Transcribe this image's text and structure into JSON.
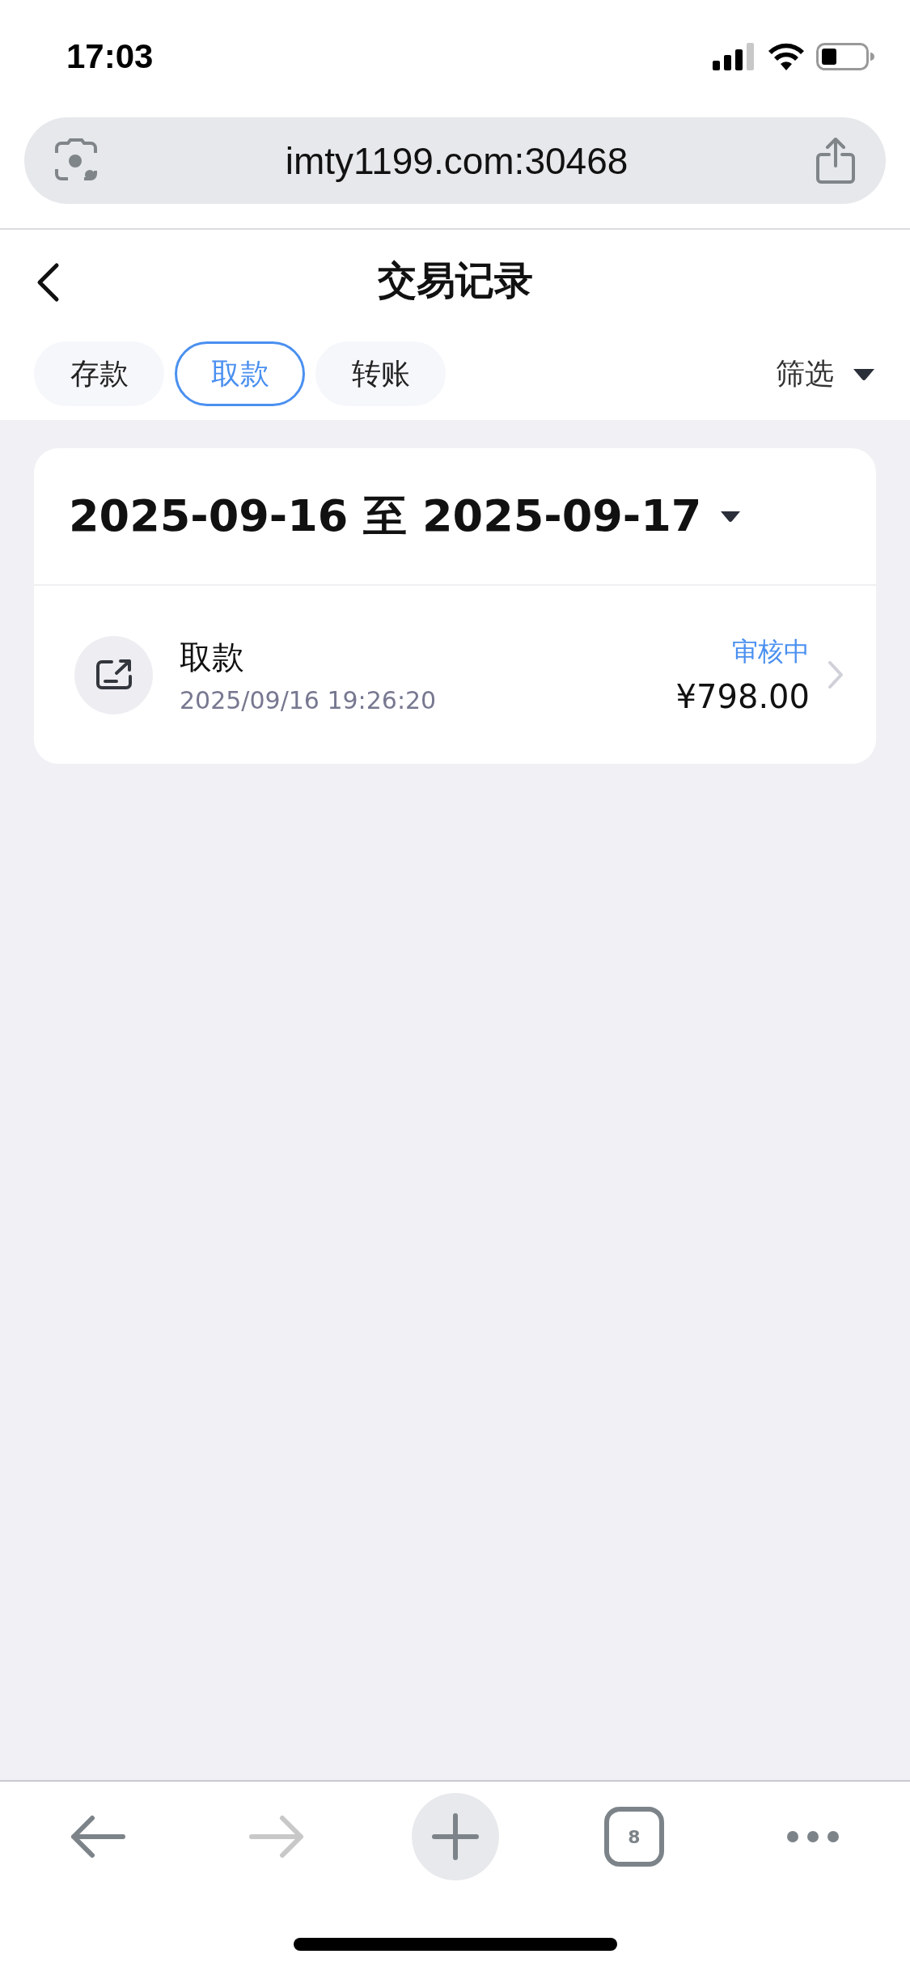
{
  "status_bar": {
    "time": "17:03"
  },
  "browser": {
    "url": "imty1199.com:30468"
  },
  "header": {
    "title": "交易记录"
  },
  "tabs": [
    {
      "label": "存款",
      "selected": false
    },
    {
      "label": "取款",
      "selected": true
    },
    {
      "label": "转账",
      "selected": false
    }
  ],
  "filter": {
    "label": "筛选"
  },
  "card": {
    "date_range": "2025-09-16 至 2025-09-17",
    "records": [
      {
        "title": "取款",
        "time": "2025/09/16 19:26:20",
        "status": "审核中",
        "amount": "¥798.00"
      }
    ]
  },
  "toolbar": [
    {
      "kind": "back",
      "disabled": false
    },
    {
      "kind": "forward",
      "disabled": true
    },
    {
      "kind": "new"
    },
    {
      "kind": "tabs",
      "count": "8"
    },
    {
      "kind": "more"
    }
  ]
}
